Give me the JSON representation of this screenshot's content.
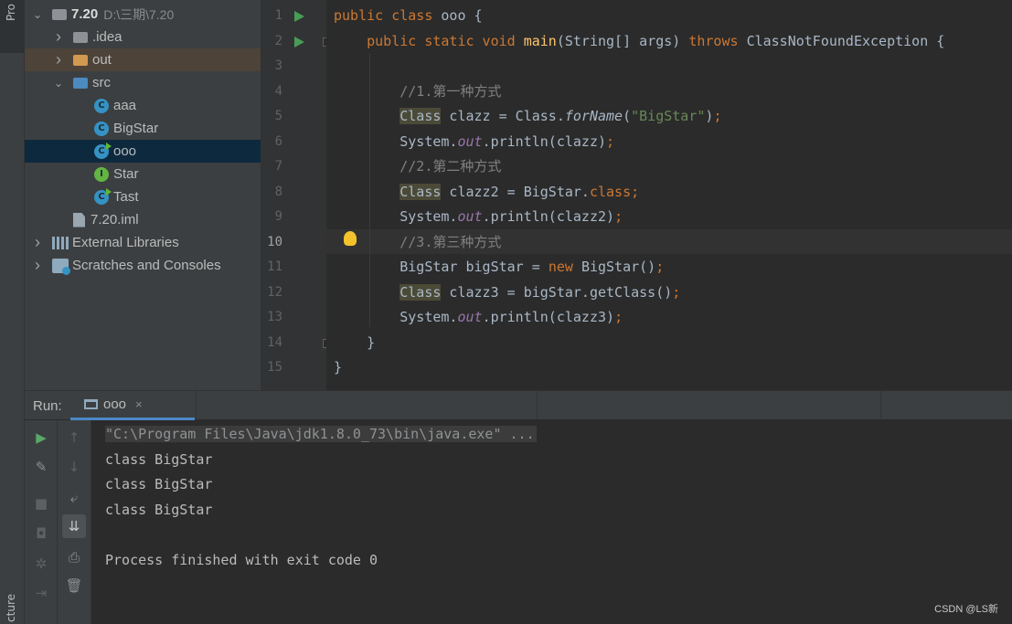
{
  "left_stripe": {
    "project_tab": "Pro",
    "structure_tab": "cture"
  },
  "project_tree": [
    {
      "indent": 0,
      "arrow": "v",
      "icon": "module-folder-icon",
      "label": "7.20",
      "extra": "D:\\三期\\7.20",
      "style": "root"
    },
    {
      "indent": 1,
      "arrow": ">",
      "icon": "folder-gray-icon",
      "label": ".idea"
    },
    {
      "indent": 1,
      "arrow": ">",
      "icon": "folder-orange-icon",
      "label": "out",
      "style": "out"
    },
    {
      "indent": 1,
      "arrow": "v",
      "icon": "folder-blue-icon",
      "label": "src"
    },
    {
      "indent": 2,
      "arrow": "",
      "icon": "class-icon",
      "label": "aaa"
    },
    {
      "indent": 2,
      "arrow": "",
      "icon": "class-icon",
      "label": "BigStar"
    },
    {
      "indent": 2,
      "arrow": "",
      "icon": "runnable-class-icon",
      "label": "ooo",
      "style": "selected"
    },
    {
      "indent": 2,
      "arrow": "",
      "icon": "interface-icon",
      "label": "Star"
    },
    {
      "indent": 2,
      "arrow": "",
      "icon": "runnable-class-icon",
      "label": "Tast"
    },
    {
      "indent": 1,
      "arrow": "",
      "icon": "module-file-icon",
      "label": "7.20.iml"
    },
    {
      "indent": 0,
      "arrow": ">",
      "icon": "libraries-icon",
      "label": "External Libraries"
    },
    {
      "indent": 0,
      "arrow": ">",
      "icon": "scratches-icon",
      "label": "Scratches and Consoles"
    }
  ],
  "editor": {
    "current_line": 10,
    "line_numbers": [
      "1",
      "2",
      "3",
      "4",
      "5",
      "6",
      "7",
      "8",
      "9",
      "10",
      "11",
      "12",
      "13",
      "14",
      "15"
    ],
    "lines": [
      [
        {
          "t": "public class ",
          "c": "kw"
        },
        {
          "t": "ooo {",
          "c": ""
        }
      ],
      [
        {
          "t": "    public static void ",
          "c": "kw"
        },
        {
          "t": "main",
          "c": "fn"
        },
        {
          "t": "(String[] args) ",
          "c": ""
        },
        {
          "t": "throws ",
          "c": "kw"
        },
        {
          "t": "ClassNotFoundException {",
          "c": ""
        }
      ],
      [],
      [
        {
          "t": "        //1.第一种方式",
          "c": "cm"
        }
      ],
      [
        {
          "t": "        ",
          "c": ""
        },
        {
          "t": "Class",
          "c": "hlcls"
        },
        {
          "t": " clazz = Class.",
          "c": ""
        },
        {
          "t": "forName",
          "c": "itc"
        },
        {
          "t": "(",
          "c": ""
        },
        {
          "t": "\"BigStar\"",
          "c": "str"
        },
        {
          "t": ")",
          "c": ""
        },
        {
          "t": ";",
          "c": "kw"
        }
      ],
      [
        {
          "t": "        System.",
          "c": ""
        },
        {
          "t": "out",
          "c": "it"
        },
        {
          "t": ".println(clazz)",
          "c": ""
        },
        {
          "t": ";",
          "c": "kw"
        }
      ],
      [
        {
          "t": "        //2.第二种方式",
          "c": "cm"
        }
      ],
      [
        {
          "t": "        ",
          "c": ""
        },
        {
          "t": "Class",
          "c": "hlcls"
        },
        {
          "t": " clazz2 = BigStar.",
          "c": ""
        },
        {
          "t": "class;",
          "c": "kw"
        }
      ],
      [
        {
          "t": "        System.",
          "c": ""
        },
        {
          "t": "out",
          "c": "it"
        },
        {
          "t": ".println(clazz2)",
          "c": ""
        },
        {
          "t": ";",
          "c": "kw"
        }
      ],
      [
        {
          "t": "        //3.第三种方式",
          "c": "cm"
        }
      ],
      [
        {
          "t": "        BigStar bigStar = ",
          "c": ""
        },
        {
          "t": "new ",
          "c": "kw"
        },
        {
          "t": "BigStar()",
          "c": ""
        },
        {
          "t": ";",
          "c": "kw"
        }
      ],
      [
        {
          "t": "        ",
          "c": ""
        },
        {
          "t": "Class",
          "c": "hlcls"
        },
        {
          "t": " clazz3 = bigStar.getClass()",
          "c": ""
        },
        {
          "t": ";",
          "c": "kw"
        }
      ],
      [
        {
          "t": "        System.",
          "c": ""
        },
        {
          "t": "out",
          "c": "it"
        },
        {
          "t": ".println(clazz3)",
          "c": ""
        },
        {
          "t": ";",
          "c": "kw"
        }
      ],
      [
        {
          "t": "    }",
          "c": ""
        }
      ],
      [
        {
          "t": "}",
          "c": ""
        }
      ]
    ]
  },
  "run_panel": {
    "label": "Run:",
    "tab_label": "ooo",
    "tab_close": "×",
    "console_lines": [
      {
        "text": "\"C:\\Program Files\\Java\\jdk1.8.0_73\\bin\\java.exe\" ...",
        "style": "cmd"
      },
      {
        "text": "class BigStar"
      },
      {
        "text": "class BigStar"
      },
      {
        "text": "class BigStar"
      },
      {
        "text": ""
      },
      {
        "text": "Process finished with exit code 0"
      }
    ]
  },
  "watermark": "CSDN @LS新",
  "colors": {
    "keyword": "#cc7832",
    "method": "#ffc66d",
    "string": "#6a8759",
    "comment": "#808080",
    "field": "#9876aa",
    "selection": "#0d293e",
    "run_green": "#499c54"
  }
}
